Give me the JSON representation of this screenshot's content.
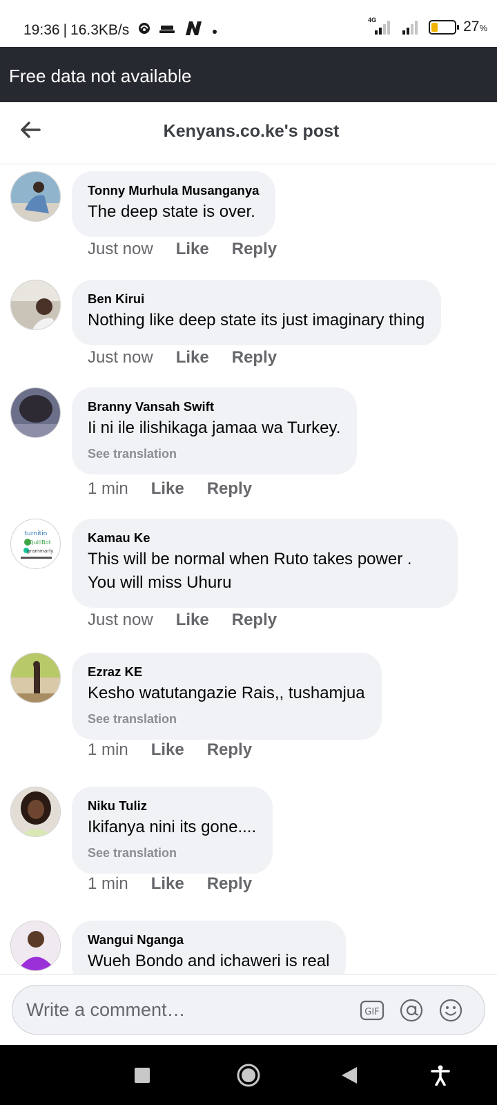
{
  "status_bar": {
    "time": "19:36",
    "separator": "|",
    "speed": "16.3KB/s",
    "network_tag": "4G",
    "battery_percent": "27",
    "battery_unit": "%",
    "battery_level": 0.27,
    "battery_color": "#f0b400",
    "icons": [
      "hotspot-icon",
      "cast-icon",
      "n-app-icon",
      "dot-icon",
      "signal-icon",
      "signal-icon",
      "battery-icon"
    ]
  },
  "banner": {
    "text": "Free data not available"
  },
  "header": {
    "title": "Kenyans.co.ke's post",
    "back_icon": "arrow-left-icon"
  },
  "comments": [
    {
      "author": "Tonny Murhula Musanganya",
      "text": "The deep state is over.",
      "translation": "",
      "time": "Just now",
      "like": "Like",
      "reply": "Reply"
    },
    {
      "author": "Ben Kirui",
      "text": "Nothing like deep state its just imaginary thing",
      "translation": "",
      "time": "Just now",
      "like": "Like",
      "reply": "Reply"
    },
    {
      "author": "Branny Vansah Swift",
      "text": "Ii ni ile ilishikaga jamaa wa Turkey.",
      "translation": "See translation",
      "time": "1 min",
      "like": "Like",
      "reply": "Reply"
    },
    {
      "author": "Kamau Ke",
      "text": "This will be normal when Ruto takes power . You will miss Uhuru",
      "translation": "",
      "time": "Just now",
      "like": "Like",
      "reply": "Reply"
    },
    {
      "author": "Ezraz KE",
      "text": "Kesho watutangazie Rais,, tushamjua",
      "translation": "See translation",
      "time": "1 min",
      "like": "Like",
      "reply": "Reply"
    },
    {
      "author": "Niku Tuliz",
      "text": "Ikifanya nini its gone....",
      "translation": "See translation",
      "time": "1 min",
      "like": "Like",
      "reply": "Reply"
    },
    {
      "author": "Wangui Nganga",
      "text": "Wueh Bondo and ichaweri is real",
      "translation": "",
      "time": "",
      "like": "",
      "reply": ""
    }
  ],
  "avatar_4_texts": [
    "turnitin",
    "QuillBot",
    "grammarly"
  ],
  "composer": {
    "placeholder": "Write a comment…",
    "icons": [
      "gif-icon",
      "at-mention-icon",
      "emoji-icon"
    ],
    "gif_label": "GIF"
  },
  "navbar": {
    "icons": [
      "recent-apps-icon",
      "home-icon",
      "back-icon",
      "accessibility-icon"
    ]
  },
  "colors": {
    "banner_bg": "#262a30",
    "bubble_bg": "#f0f2f5",
    "secondary_text": "#65676b"
  }
}
